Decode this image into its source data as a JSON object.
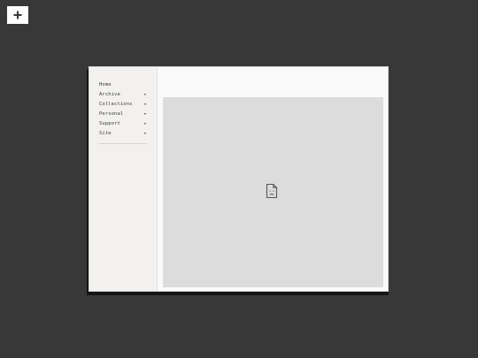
{
  "toolbar": {
    "add_icon": "plus-icon"
  },
  "sidebar": {
    "items": [
      {
        "label": "Home",
        "has_submenu": false
      },
      {
        "label": "Archive",
        "has_submenu": true
      },
      {
        "label": "Collections",
        "has_submenu": true
      },
      {
        "label": "Personal",
        "has_submenu": true
      },
      {
        "label": "Support",
        "has_submenu": true
      },
      {
        "label": "Site",
        "has_submenu": true
      }
    ]
  },
  "content": {
    "placeholder_icon": "sad-file-icon"
  },
  "colors": {
    "desktop": "#383838",
    "window": "#fafafa",
    "sidebar": "#f2f1ef",
    "frame": "#dcdcdc"
  }
}
